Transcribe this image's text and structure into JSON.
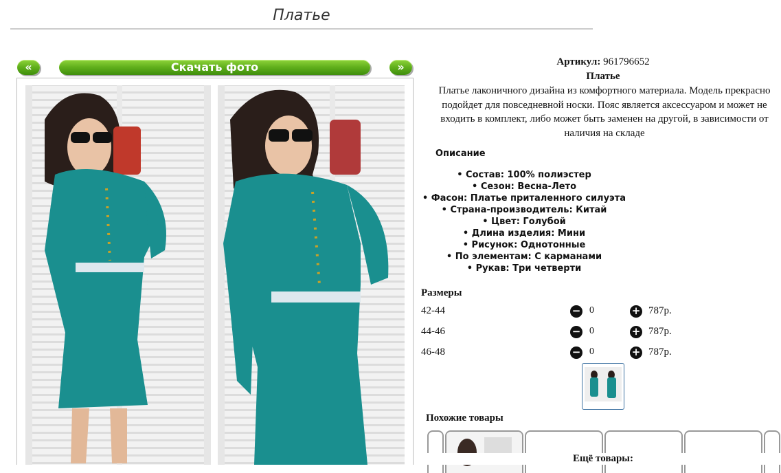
{
  "page": {
    "title": "Платье"
  },
  "gallery": {
    "prev_label": "«",
    "download_label": "Скачать фото",
    "next_label": "»"
  },
  "product": {
    "sku_label": "Артикул:",
    "sku_value": "961796652",
    "name": "Платье",
    "description": "Платье лаконичного дизайна из комфортного материала. Модель прекрасно подойдет для повседневной носки. Пояс является аксессуаром и может не входить в комплект, либо может быть заменен на другой, в зависимости от наличия на складе"
  },
  "details": {
    "heading": "Описание",
    "attributes": [
      "Состав: 100% полиэстер",
      "Сезон: Весна-Лето",
      "Фасон: Платье приталенного силуэта",
      "Страна-производитель: Китай",
      "Цвет: Голубой",
      "Длина изделия: Мини",
      "Рисунок: Однотонные",
      "По элементам: С карманами",
      "Рукав: Три четверти"
    ]
  },
  "sizes": {
    "heading": "Размеры",
    "rows": [
      {
        "size": "42-44",
        "qty": "0",
        "price": "787р."
      },
      {
        "size": "44-46",
        "qty": "0",
        "price": "787р."
      },
      {
        "size": "46-48",
        "qty": "0",
        "price": "787р."
      }
    ],
    "minus_icon": "minus-circle-icon",
    "plus_icon": "plus-circle-icon"
  },
  "similar": {
    "heading": "Похожие товары"
  },
  "more": {
    "heading": "Ещё товары:"
  },
  "colors": {
    "button_green": "#5fae1b",
    "dress_teal": "#1a8f8f"
  }
}
